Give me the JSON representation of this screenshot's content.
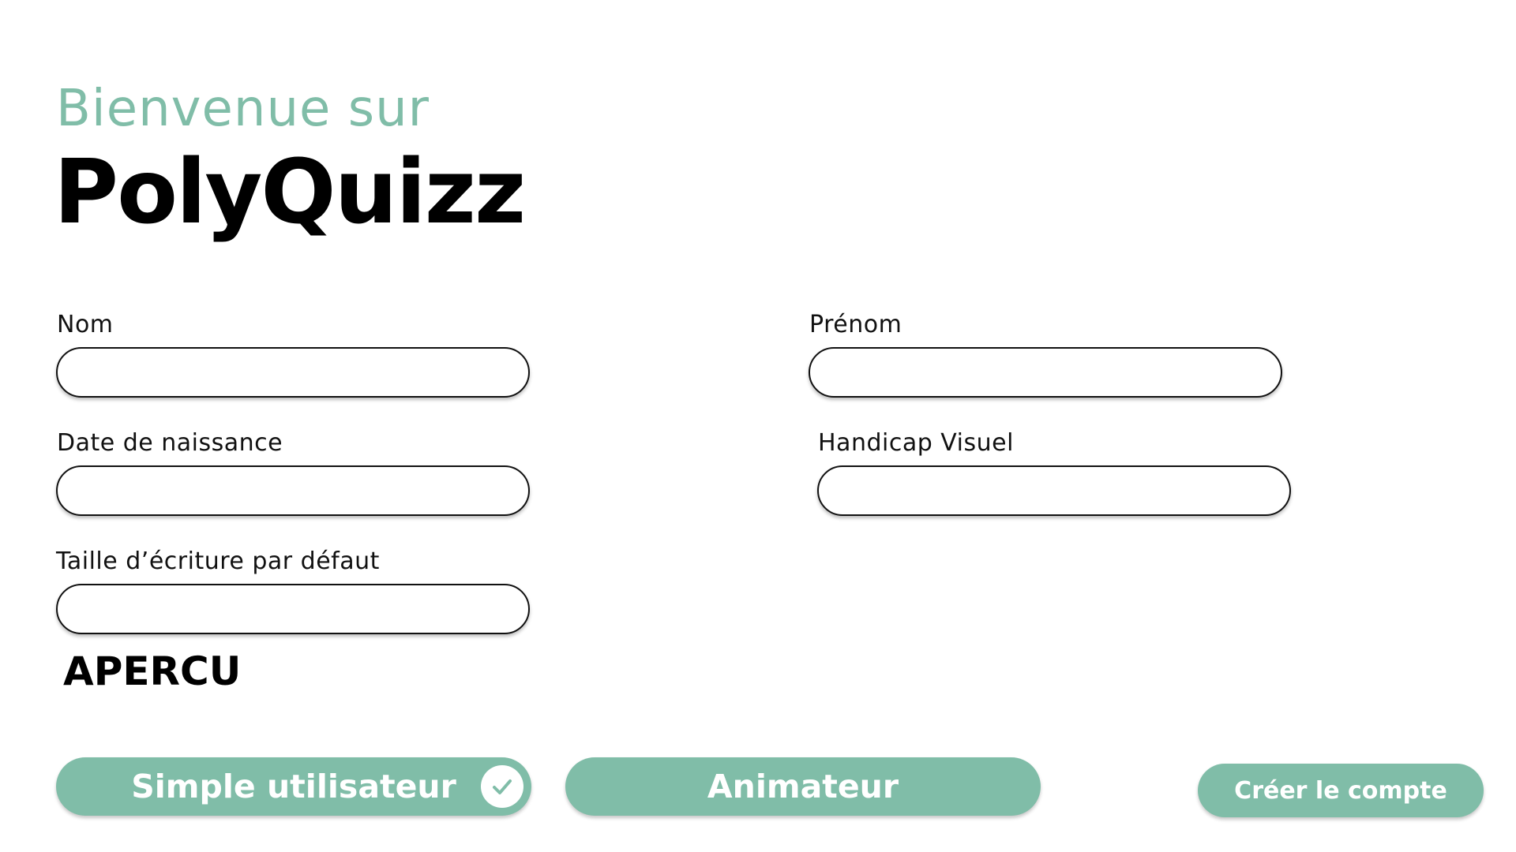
{
  "header": {
    "welcome": "Bienvenue sur",
    "app_name": "PolyQuizz"
  },
  "form": {
    "nom": {
      "label": "Nom",
      "value": ""
    },
    "prenom": {
      "label": "Prénom",
      "value": ""
    },
    "date_naissance": {
      "label": "Date de naissance",
      "value": ""
    },
    "handicap_visuel": {
      "label": "Handicap Visuel",
      "value": ""
    },
    "taille_ecriture": {
      "label": "Taille d’écriture par défaut",
      "value": ""
    },
    "preview_label": "APERCU"
  },
  "roles": {
    "simple_user": {
      "label": "Simple utilisateur",
      "selected": true,
      "icon": "check-icon"
    },
    "animator": {
      "label": "Animateur",
      "selected": false
    }
  },
  "actions": {
    "create_account": "Créer le compte"
  },
  "colors": {
    "accent": "#80bda8",
    "text": "#000000",
    "background": "#ffffff"
  }
}
